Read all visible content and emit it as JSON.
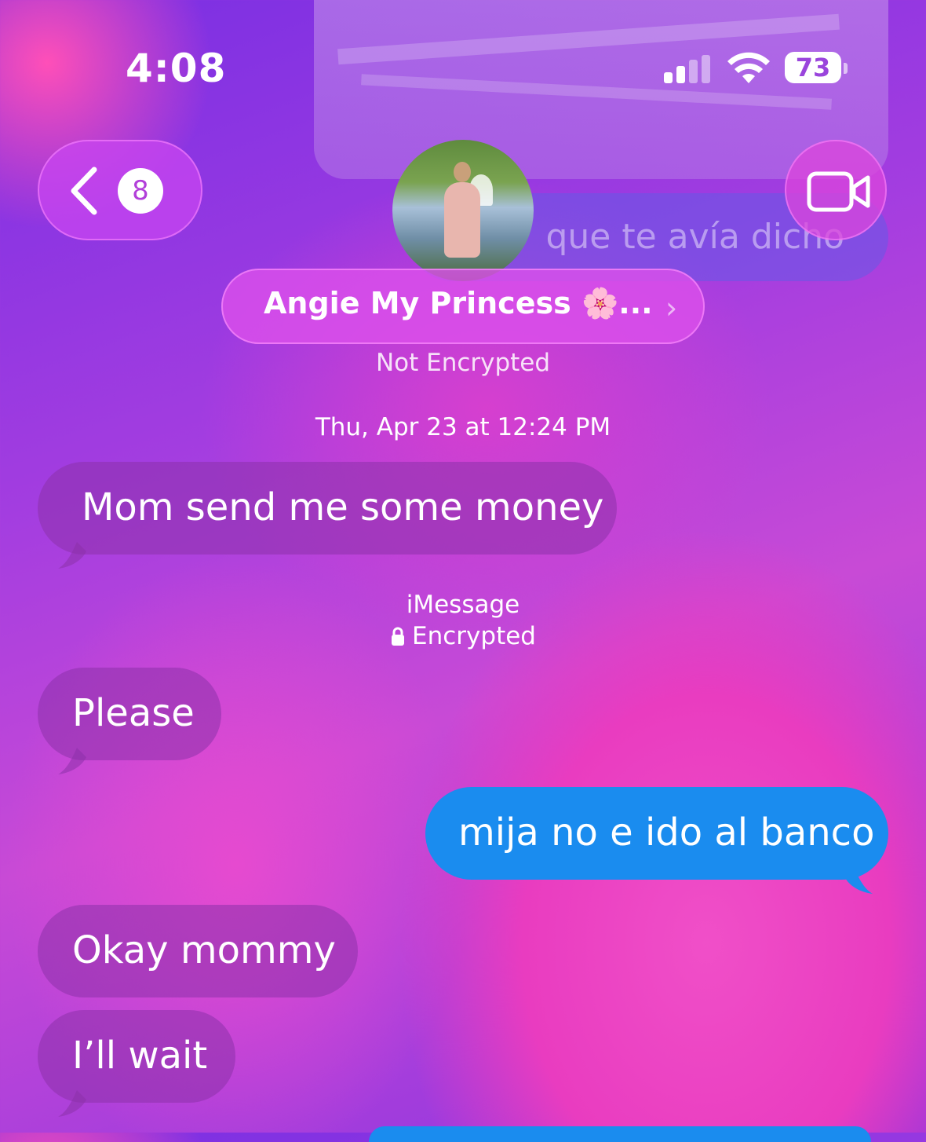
{
  "status_bar": {
    "time": "4:08",
    "battery": "73"
  },
  "background": {
    "faded_message": "que te avía dicho"
  },
  "nav": {
    "back_badge": "8",
    "contact_name": "Angie My Princess 🌸...",
    "encryption": "Not Encrypted"
  },
  "conversation": {
    "timestamp": "Thu, Apr 23 at 12:24 PM",
    "service_label": "iMessage",
    "service_status": "Encrypted",
    "messages": [
      {
        "direction": "incoming",
        "text": "Mom send me some money"
      },
      {
        "direction": "incoming",
        "text": "Please"
      },
      {
        "direction": "outgoing",
        "text": "mija no e ido al banco"
      },
      {
        "direction": "incoming",
        "text": "Okay mommy"
      },
      {
        "direction": "incoming",
        "text": "I’ll wait"
      }
    ]
  },
  "colors": {
    "outgoing_bubble": "#1a8cef",
    "incoming_bubble": "#8c32aa"
  },
  "icons": [
    "signal-icon",
    "wifi-icon",
    "battery-icon",
    "chevron-left-icon",
    "video-camera-icon",
    "lock-icon",
    "chevron-right-icon"
  ]
}
